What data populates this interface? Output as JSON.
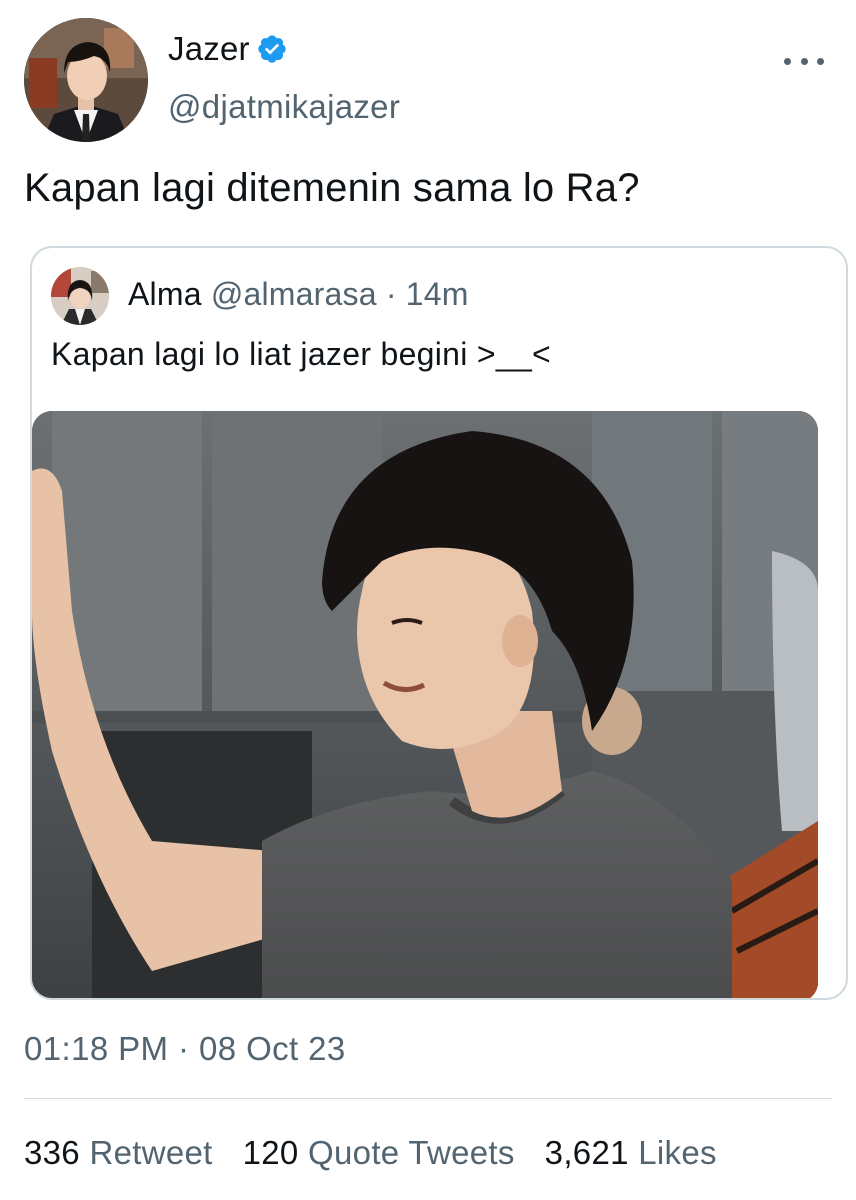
{
  "author": {
    "name": "Jazer",
    "handle": "@djatmikajazer",
    "verified": true
  },
  "tweet": {
    "text": "Kapan lagi ditemenin sama lo Ra?"
  },
  "quoted": {
    "name": "Alma",
    "handle": "@almarasa",
    "separator": "·",
    "time": "14m",
    "text": "Kapan lagi lo liat jazer begini >__<"
  },
  "meta": {
    "time": "01:18 PM",
    "separator": "·",
    "date": "08 Oct 23"
  },
  "stats": {
    "retweets_count": "336",
    "retweets_label": "Retweet",
    "quotes_count": "120",
    "quotes_label": "Quote Tweets",
    "likes_count": "3,621",
    "likes_label": "Likes"
  },
  "colors": {
    "text_primary": "#0f1419",
    "text_secondary": "#536471",
    "verified_blue": "#1d9bf0",
    "border": "#cfd9de"
  },
  "icons": {
    "verified": "verified-badge-icon",
    "more": "more-horizontal-icon"
  }
}
